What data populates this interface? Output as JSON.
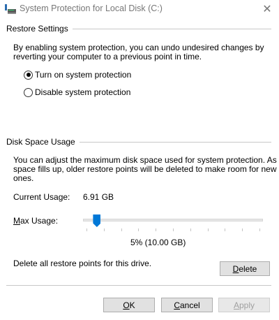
{
  "window": {
    "title": "System Protection for Local Disk (C:)",
    "close_glyph": "✕"
  },
  "restore": {
    "group_title": "Restore Settings",
    "description_line1": "By enabling system protection, you can undo undesired changes by",
    "description_line2": "reverting your computer to a previous point in time.",
    "options": [
      {
        "label": "Turn on system protection",
        "checked": true
      },
      {
        "label": "Disable system protection",
        "checked": false
      }
    ]
  },
  "disk": {
    "group_title": "Disk Space Usage",
    "description_line1": "You can adjust the maximum disk space used for system protection. As",
    "description_line2": "space fills up, older restore points will be deleted to make room for new",
    "description_line3": "ones.",
    "current_usage_label": "Current Usage:",
    "current_usage_value": "6.91 GB",
    "max_usage_label": "Max Usage:",
    "max_usage_value": "5% (10.00 GB)",
    "max_usage_fraction": 0.05,
    "delete_text": "Delete all restore points for this drive.",
    "delete_button": "Delete"
  },
  "buttons": {
    "ok": "OK",
    "cancel": "Cancel",
    "apply": "Apply"
  },
  "colors": {
    "accent": "#0078d7"
  },
  "icons": {
    "app": "system-protection-icon",
    "close": "close-icon"
  }
}
